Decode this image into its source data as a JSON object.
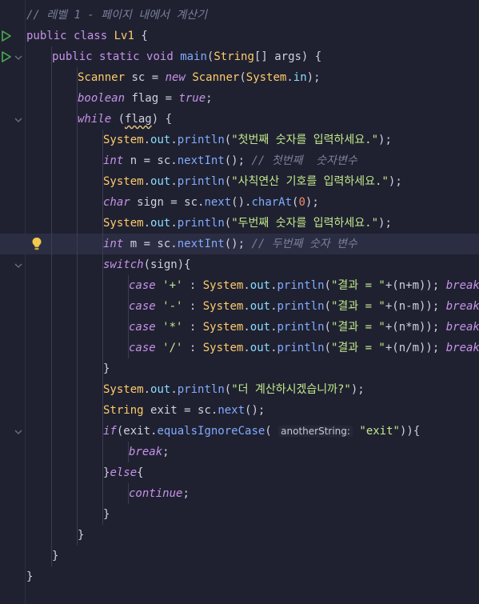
{
  "editor": {
    "lines": [
      {
        "indent": 0,
        "tokens": [
          {
            "t": "// 레벨 1 - 페이지 내에서 계산기",
            "c": "cm"
          }
        ]
      },
      {
        "indent": 0,
        "run": true,
        "tokens": [
          {
            "t": "public ",
            "c": "kw"
          },
          {
            "t": "class ",
            "c": "kw"
          },
          {
            "t": "Lv1 ",
            "c": "ty"
          },
          {
            "t": "{",
            "c": "id"
          }
        ]
      },
      {
        "indent": 1,
        "run": true,
        "fold": true,
        "tokens": [
          {
            "t": "public ",
            "c": "kw"
          },
          {
            "t": "static ",
            "c": "kw"
          },
          {
            "t": "void ",
            "c": "kw"
          },
          {
            "t": "main",
            "c": "fn"
          },
          {
            "t": "(",
            "c": "id"
          },
          {
            "t": "String",
            "c": "ty"
          },
          {
            "t": "[] args) {",
            "c": "id"
          }
        ]
      },
      {
        "indent": 2,
        "tokens": [
          {
            "t": "Scanner ",
            "c": "ty"
          },
          {
            "t": "sc = ",
            "c": "id"
          },
          {
            "t": "new ",
            "c": "kwi"
          },
          {
            "t": "Scanner",
            "c": "ty"
          },
          {
            "t": "(",
            "c": "id"
          },
          {
            "t": "System",
            "c": "ty"
          },
          {
            "t": ".",
            "c": "id"
          },
          {
            "t": "in",
            "c": "fd"
          },
          {
            "t": ");",
            "c": "id"
          }
        ]
      },
      {
        "indent": 2,
        "tokens": [
          {
            "t": "boolean ",
            "c": "kwi"
          },
          {
            "t": "flag = ",
            "c": "id"
          },
          {
            "t": "true",
            "c": "kwi"
          },
          {
            "t": ";",
            "c": "id"
          }
        ]
      },
      {
        "indent": 2,
        "fold": true,
        "tokens": [
          {
            "t": "while ",
            "c": "kwi"
          },
          {
            "t": "(",
            "c": "id"
          },
          {
            "t": "flag",
            "c": "id",
            "sq": true
          },
          {
            "t": ") {",
            "c": "id"
          }
        ]
      },
      {
        "indent": 3,
        "tokens": [
          {
            "t": "System",
            "c": "ty"
          },
          {
            "t": ".",
            "c": "id"
          },
          {
            "t": "out",
            "c": "fd"
          },
          {
            "t": ".",
            "c": "id"
          },
          {
            "t": "println",
            "c": "fn"
          },
          {
            "t": "(",
            "c": "id"
          },
          {
            "t": "\"첫번째 숫자를 입력하세요.\"",
            "c": "st"
          },
          {
            "t": ");",
            "c": "id"
          }
        ]
      },
      {
        "indent": 3,
        "tokens": [
          {
            "t": "int ",
            "c": "kwi"
          },
          {
            "t": "n = sc.",
            "c": "id"
          },
          {
            "t": "nextInt",
            "c": "fn"
          },
          {
            "t": "(); ",
            "c": "id"
          },
          {
            "t": "// 첫번째  숫자변수",
            "c": "cm"
          }
        ]
      },
      {
        "indent": 3,
        "tokens": [
          {
            "t": "System",
            "c": "ty"
          },
          {
            "t": ".",
            "c": "id"
          },
          {
            "t": "out",
            "c": "fd"
          },
          {
            "t": ".",
            "c": "id"
          },
          {
            "t": "println",
            "c": "fn"
          },
          {
            "t": "(",
            "c": "id"
          },
          {
            "t": "\"사칙연산 기호를 입력하세요.\"",
            "c": "st"
          },
          {
            "t": ");",
            "c": "id"
          }
        ]
      },
      {
        "indent": 3,
        "tokens": [
          {
            "t": "char ",
            "c": "kwi"
          },
          {
            "t": "sign = sc.",
            "c": "id"
          },
          {
            "t": "next",
            "c": "fn"
          },
          {
            "t": "().",
            "c": "id"
          },
          {
            "t": "charAt",
            "c": "fn"
          },
          {
            "t": "(",
            "c": "id"
          },
          {
            "t": "0",
            "c": "nu"
          },
          {
            "t": ");",
            "c": "id"
          }
        ]
      },
      {
        "indent": 3,
        "tokens": [
          {
            "t": "System",
            "c": "ty"
          },
          {
            "t": ".",
            "c": "id"
          },
          {
            "t": "out",
            "c": "fd"
          },
          {
            "t": ".",
            "c": "id"
          },
          {
            "t": "println",
            "c": "fn"
          },
          {
            "t": "(",
            "c": "id"
          },
          {
            "t": "\"두번째 숫자를 입력하세요.\"",
            "c": "st"
          },
          {
            "t": ");",
            "c": "id"
          }
        ]
      },
      {
        "indent": 3,
        "current": true,
        "bulb": true,
        "tokens": [
          {
            "t": "int ",
            "c": "kwi"
          },
          {
            "t": "m = sc.",
            "c": "id"
          },
          {
            "t": "nextInt",
            "c": "fn"
          },
          {
            "t": "(); ",
            "c": "id"
          },
          {
            "t": "// 두번째 숫자 변수",
            "c": "cm"
          }
        ]
      },
      {
        "indent": 3,
        "fold": true,
        "tokens": [
          {
            "t": "switch",
            "c": "kwi"
          },
          {
            "t": "(sign){",
            "c": "id"
          }
        ]
      },
      {
        "indent": 4,
        "tokens": [
          {
            "t": "case ",
            "c": "kwi"
          },
          {
            "t": "'+'",
            "c": "st"
          },
          {
            "t": " : ",
            "c": "id"
          },
          {
            "t": "System",
            "c": "ty"
          },
          {
            "t": ".",
            "c": "id"
          },
          {
            "t": "out",
            "c": "fd"
          },
          {
            "t": ".",
            "c": "id"
          },
          {
            "t": "println",
            "c": "fn"
          },
          {
            "t": "(",
            "c": "id"
          },
          {
            "t": "\"결과 = \"",
            "c": "st"
          },
          {
            "t": "+(n+m)); ",
            "c": "id"
          },
          {
            "t": "break",
            "c": "kwi"
          },
          {
            "t": ";",
            "c": "id"
          }
        ]
      },
      {
        "indent": 4,
        "tokens": [
          {
            "t": "case ",
            "c": "kwi"
          },
          {
            "t": "'-'",
            "c": "st"
          },
          {
            "t": " : ",
            "c": "id"
          },
          {
            "t": "System",
            "c": "ty"
          },
          {
            "t": ".",
            "c": "id"
          },
          {
            "t": "out",
            "c": "fd"
          },
          {
            "t": ".",
            "c": "id"
          },
          {
            "t": "println",
            "c": "fn"
          },
          {
            "t": "(",
            "c": "id"
          },
          {
            "t": "\"결과 = \"",
            "c": "st"
          },
          {
            "t": "+(n-m)); ",
            "c": "id"
          },
          {
            "t": "break",
            "c": "kwi"
          },
          {
            "t": ";",
            "c": "id"
          }
        ]
      },
      {
        "indent": 4,
        "tokens": [
          {
            "t": "case ",
            "c": "kwi"
          },
          {
            "t": "'*'",
            "c": "st"
          },
          {
            "t": " : ",
            "c": "id"
          },
          {
            "t": "System",
            "c": "ty"
          },
          {
            "t": ".",
            "c": "id"
          },
          {
            "t": "out",
            "c": "fd"
          },
          {
            "t": ".",
            "c": "id"
          },
          {
            "t": "println",
            "c": "fn"
          },
          {
            "t": "(",
            "c": "id"
          },
          {
            "t": "\"결과 = \"",
            "c": "st"
          },
          {
            "t": "+(n*m)); ",
            "c": "id"
          },
          {
            "t": "break",
            "c": "kwi"
          },
          {
            "t": ";",
            "c": "id"
          }
        ]
      },
      {
        "indent": 4,
        "tokens": [
          {
            "t": "case ",
            "c": "kwi"
          },
          {
            "t": "'/'",
            "c": "st"
          },
          {
            "t": " : ",
            "c": "id"
          },
          {
            "t": "System",
            "c": "ty"
          },
          {
            "t": ".",
            "c": "id"
          },
          {
            "t": "out",
            "c": "fd"
          },
          {
            "t": ".",
            "c": "id"
          },
          {
            "t": "println",
            "c": "fn"
          },
          {
            "t": "(",
            "c": "id"
          },
          {
            "t": "\"결과 = \"",
            "c": "st"
          },
          {
            "t": "+(n/m)); ",
            "c": "id"
          },
          {
            "t": "break",
            "c": "kwi"
          },
          {
            "t": ";",
            "c": "id"
          }
        ]
      },
      {
        "indent": 3,
        "tokens": [
          {
            "t": "}",
            "c": "id"
          }
        ]
      },
      {
        "indent": 3,
        "tokens": [
          {
            "t": "System",
            "c": "ty"
          },
          {
            "t": ".",
            "c": "id"
          },
          {
            "t": "out",
            "c": "fd"
          },
          {
            "t": ".",
            "c": "id"
          },
          {
            "t": "println",
            "c": "fn"
          },
          {
            "t": "(",
            "c": "id"
          },
          {
            "t": "\"더 계산하시겠습니까?\"",
            "c": "st"
          },
          {
            "t": ");",
            "c": "id"
          }
        ]
      },
      {
        "indent": 3,
        "tokens": [
          {
            "t": "String ",
            "c": "ty"
          },
          {
            "t": "exit = sc.",
            "c": "id"
          },
          {
            "t": "next",
            "c": "fn"
          },
          {
            "t": "();",
            "c": "id"
          }
        ]
      },
      {
        "indent": 3,
        "fold": true,
        "tokens": [
          {
            "t": "if",
            "c": "kwi"
          },
          {
            "t": "(exit.",
            "c": "id"
          },
          {
            "t": "equalsIgnoreCase",
            "c": "fn"
          },
          {
            "t": "( ",
            "c": "id"
          },
          {
            "t": "anotherString:",
            "c": "hint"
          },
          {
            "t": " ",
            "c": "id"
          },
          {
            "t": "\"exit\"",
            "c": "st"
          },
          {
            "t": ")){",
            "c": "id"
          }
        ]
      },
      {
        "indent": 4,
        "tokens": [
          {
            "t": "break",
            "c": "kwi"
          },
          {
            "t": ";",
            "c": "id"
          }
        ]
      },
      {
        "indent": 3,
        "tokens": [
          {
            "t": "}",
            "c": "id"
          },
          {
            "t": "else",
            "c": "kwi"
          },
          {
            "t": "{",
            "c": "id"
          }
        ]
      },
      {
        "indent": 4,
        "tokens": [
          {
            "t": "continue",
            "c": "kwi"
          },
          {
            "t": ";",
            "c": "id"
          }
        ]
      },
      {
        "indent": 3,
        "tokens": [
          {
            "t": "}",
            "c": "id"
          }
        ]
      },
      {
        "indent": 2,
        "tokens": [
          {
            "t": "}",
            "c": "id"
          }
        ]
      },
      {
        "indent": 1,
        "tokens": [
          {
            "t": "}",
            "c": "id"
          }
        ]
      },
      {
        "indent": 0,
        "tokens": [
          {
            "t": "}",
            "c": "id"
          }
        ]
      }
    ]
  },
  "colors": {
    "background": "#1f2130",
    "current_line": "#2b2d42",
    "run_icon": "#4caf50",
    "bulb_icon": "#f2c94c"
  },
  "icons": {
    "run": "run-gutter-icon",
    "fold": "fold-chevron-icon",
    "bulb": "lightbulb-icon"
  }
}
